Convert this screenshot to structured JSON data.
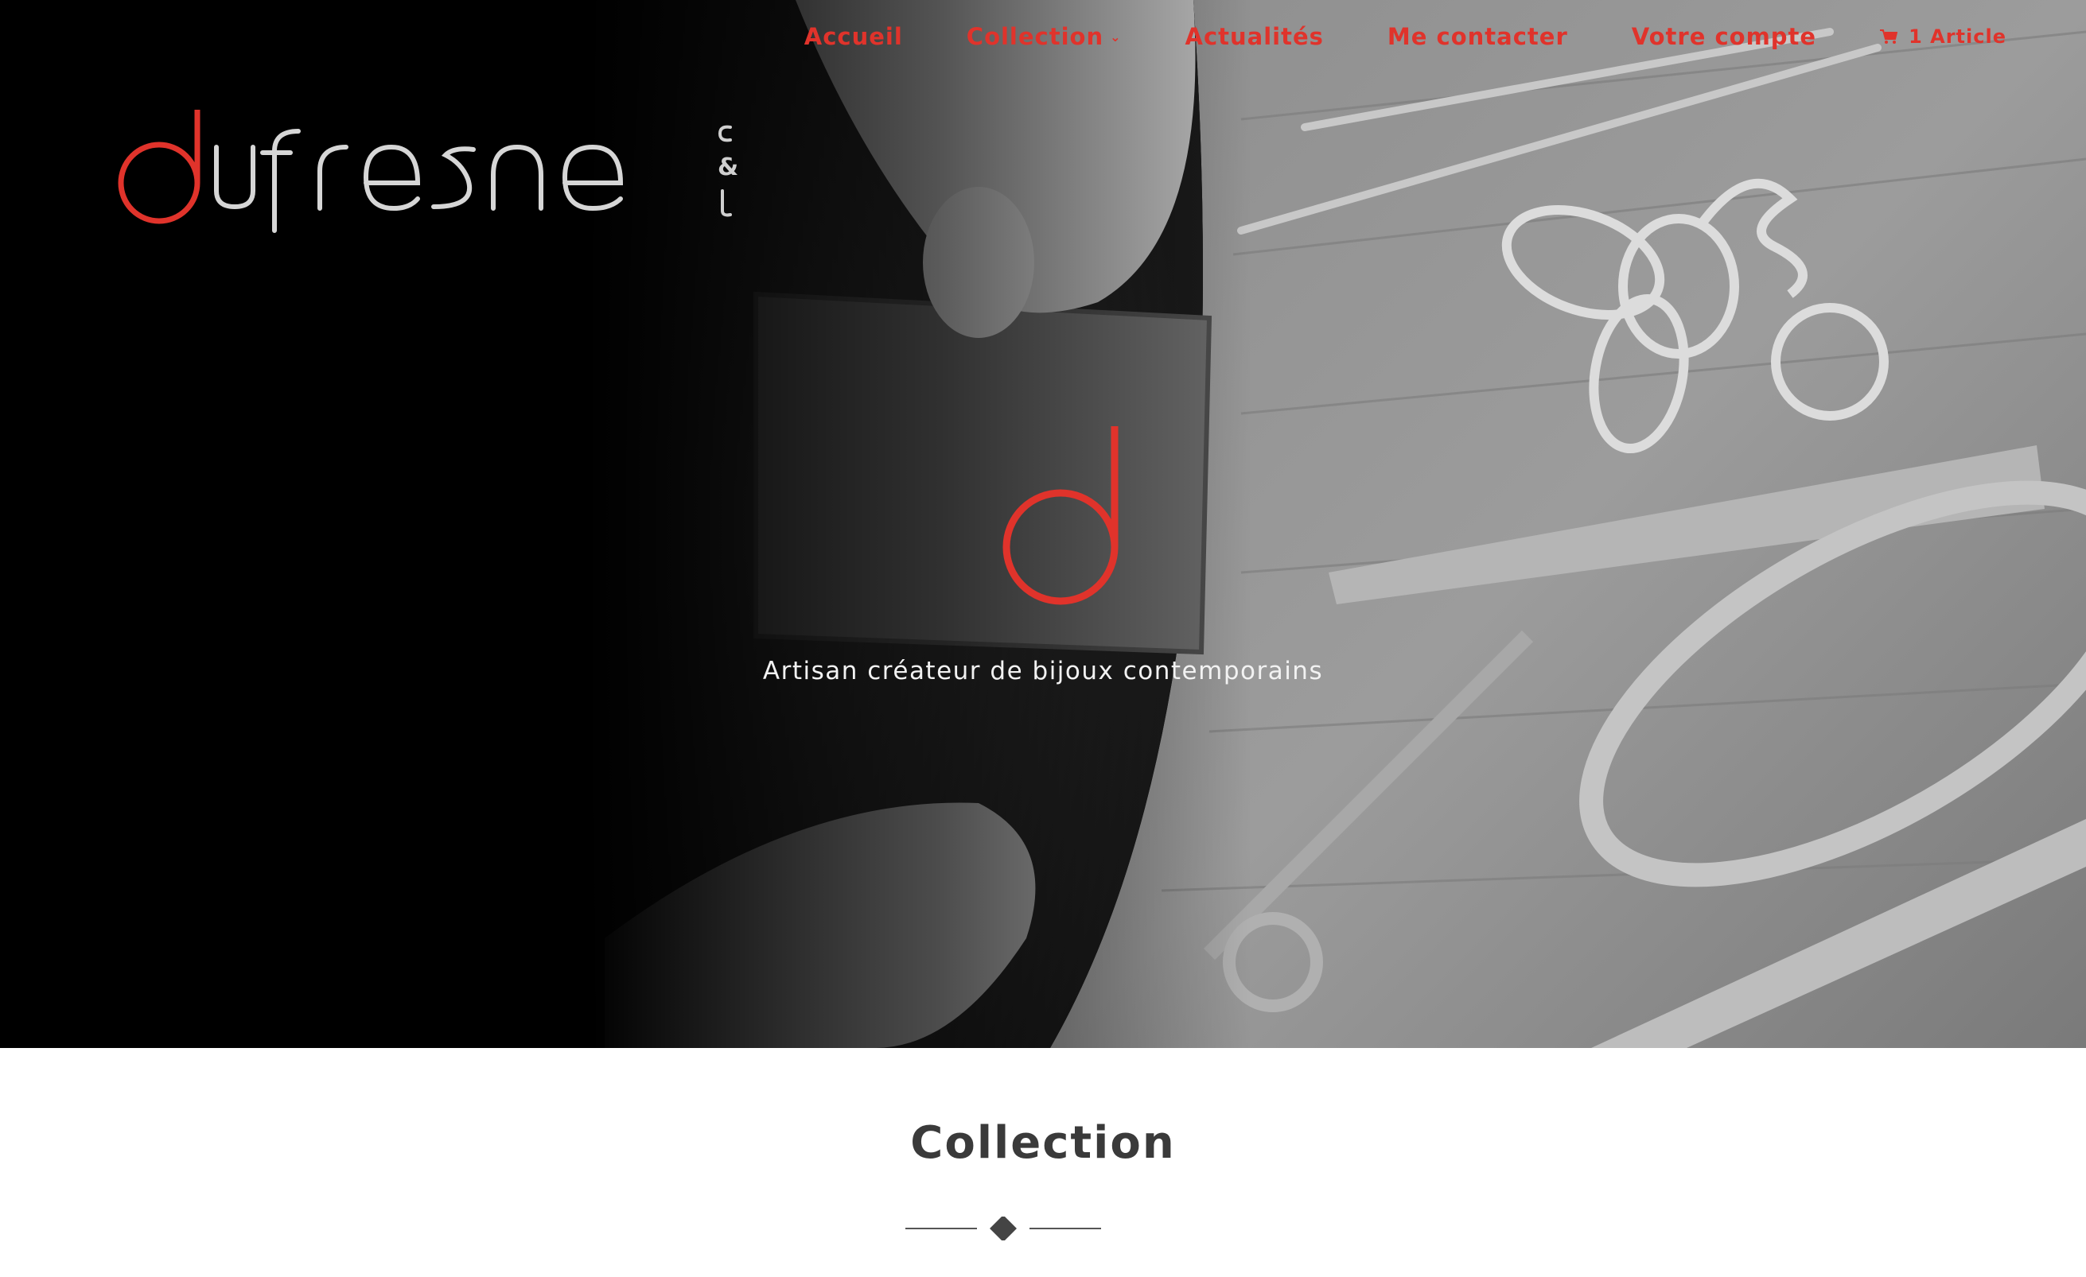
{
  "nav": {
    "items": [
      {
        "label": "Accueil"
      },
      {
        "label": "Collection",
        "has_dropdown": true
      },
      {
        "label": "Actualités"
      },
      {
        "label": "Me contacter"
      },
      {
        "label": "Votre compte"
      }
    ],
    "cart_label": "1 Article",
    "accent_color": "#e0332b"
  },
  "logo": {
    "wordmark": "dufresne",
    "side_letters": [
      "c",
      "&",
      "l"
    ]
  },
  "hero": {
    "mark": "d",
    "tagline": "Artisan créateur de bijoux contemporains"
  },
  "section": {
    "title": "Collection"
  },
  "icons": {
    "cart": "cart-icon",
    "dropdown": "chevron-down-icon",
    "divider": "diamond-icon"
  }
}
